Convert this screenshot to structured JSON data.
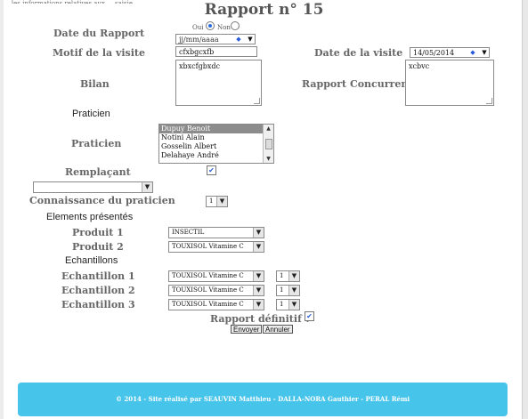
{
  "header": {
    "top_text": "... les informations relatives aux ... saisie... ... ... ...",
    "title": "Rapport n° 15"
  },
  "form": {
    "date_rapport_label": "Date du Rapport",
    "radio_oui": "Oui",
    "radio_non": "Non",
    "date_rapport_placeholder": "jj/mm/aaaa",
    "motif_label": "Motif de la visite",
    "motif_value": "cfxbgcxfb",
    "date_visite_label": "Date de la visite",
    "date_visite_value": "14/05/2014",
    "bilan_label": "Bilan",
    "bilan_value": "xbxcfgbxdc",
    "concurrence_label": "Rapport Concurrence",
    "concurrence_value": "xcbvc",
    "praticien_section": "Praticien",
    "praticien_label": "Praticien",
    "praticien_options": [
      "Dupuy Benoit",
      "Notini Alain",
      "Gosselin Albert",
      "Delahaye André"
    ],
    "remplacant_label": "Remplaçant",
    "remplacant_select": "",
    "connaissance_label": "Connaissance du praticien",
    "connaissance_value": "1",
    "elements_section": "Elements présentés",
    "produit1_label": "Produit 1",
    "produit1_value": "INSECTIL",
    "produit2_label": "Produit 2",
    "produit2_value": "TOUXISOL Vitamine C",
    "echantillons_section": "Echantillons",
    "echantillons": [
      {
        "label": "Echantillon 1",
        "value": "TOUXISOL Vitamine C",
        "qty": "1"
      },
      {
        "label": "Echantillon 2",
        "value": "TOUXISOL Vitamine C",
        "qty": "1"
      },
      {
        "label": "Echantillon 3",
        "value": "TOUXISOL Vitamine C",
        "qty": "1"
      }
    ],
    "definitif_label": "Rapport définitif ?",
    "envoyer_label": "Envoyer",
    "annuler_label": "Annuler"
  },
  "footer": {
    "text": "© 2014 - Site réalisé par   SEAUVIN Matthieu - DALLA-NORA Gauthier - PERAL Rémi",
    "color": "#47c4ea"
  },
  "icons": {
    "dropdown": "chevron-down-icon",
    "checkbox": "check-icon",
    "spinner": "spinner-arrows-icon"
  }
}
